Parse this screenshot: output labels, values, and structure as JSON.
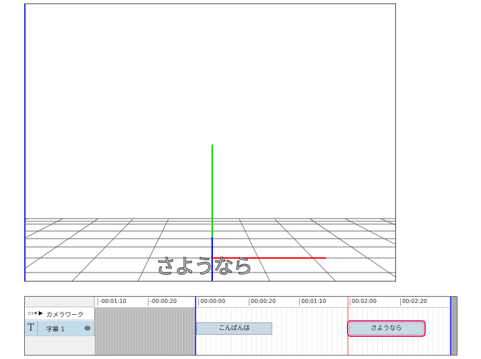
{
  "viewport": {
    "caption": "さようなら",
    "axis_colors": {
      "x": "#ff0000",
      "y": "#00dd00",
      "z": "#0000ff"
    }
  },
  "timeline": {
    "layers": [
      {
        "icon": "camera-icon",
        "name": "カメラワーク",
        "expand": "▶"
      },
      {
        "icon": "text-icon",
        "name": "字幕 1",
        "icon_glyph": "T",
        "visibility": "eye-icon"
      }
    ],
    "ruler": [
      "-00:01:10",
      "-00:00:20",
      "00:00:00",
      "00:00:20",
      "00:01:10",
      "00:02:00",
      "00:02:20"
    ],
    "clips": [
      {
        "label": "こんばんは"
      },
      {
        "label": "さようなら",
        "selected": true
      }
    ],
    "colors": {
      "playhead": "#ff5555",
      "selection": "#e0206a",
      "marker": "#4444ff"
    }
  }
}
